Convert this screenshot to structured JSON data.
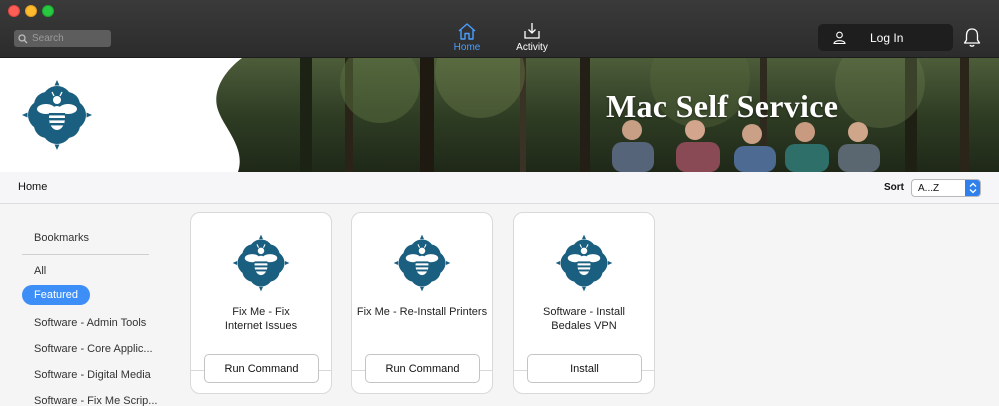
{
  "window": {
    "controls": [
      "close",
      "minimize",
      "zoom"
    ]
  },
  "toolbar": {
    "search": {
      "placeholder": "Search",
      "value": ""
    },
    "nav": [
      {
        "label": "Home",
        "icon": "home-icon",
        "active": true
      },
      {
        "label": "Activity",
        "icon": "download-tray-icon",
        "active": false
      }
    ],
    "login_label": "Log In",
    "accent_color": "#4a9fff"
  },
  "banner": {
    "title": "Mac Self Service"
  },
  "subheader": {
    "breadcrumb": "Home",
    "sort_label": "Sort",
    "sort_value": "A...Z"
  },
  "sidebar": {
    "heading": "Bookmarks",
    "items": [
      {
        "label": "All"
      },
      {
        "label": "Featured",
        "active": true
      },
      {
        "label": "Software - Admin Tools"
      },
      {
        "label": "Software - Core Applic..."
      },
      {
        "label": "Software - Digital Media"
      },
      {
        "label": "Software - Fix Me Scrip..."
      }
    ]
  },
  "cards": [
    {
      "title_line1": "Fix Me - Fix",
      "title_line2": "Internet Issues",
      "action": "Run Command"
    },
    {
      "title_line1": "Fix Me - Re-Install Printers",
      "title_line2": "",
      "action": "Run Command"
    },
    {
      "title_line1": "Software - Install",
      "title_line2": "Bedales VPN",
      "action": "Install"
    }
  ],
  "colors": {
    "logo_teal": "#1b5f80",
    "active_pill": "#3e8ef7"
  }
}
